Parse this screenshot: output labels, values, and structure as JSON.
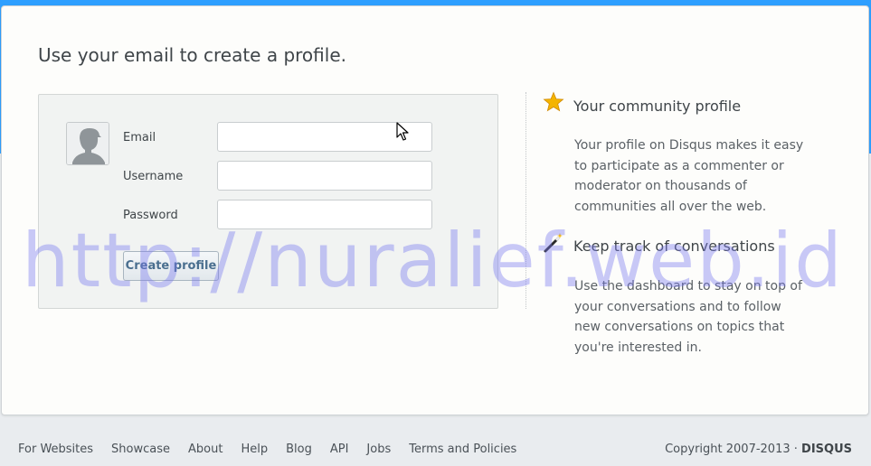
{
  "page": {
    "heading": "Use your email to create a profile."
  },
  "form": {
    "email_label": "Email",
    "email_value": "",
    "username_label": "Username",
    "username_value": "",
    "password_label": "Password",
    "password_value": "",
    "submit_label": "Create profile"
  },
  "features": [
    {
      "icon": "star-icon",
      "title": "Your community profile",
      "body": "Your profile on Disqus makes it easy to participate as a commenter or moderator on thousands of communities all over the web."
    },
    {
      "icon": "magic-wand-icon",
      "title": "Keep track of conversations",
      "body": "Use the dashboard to stay on top of your conversations and to follow new conversations on topics that you're interested in."
    }
  ],
  "watermark": "http://nuralief.web.id",
  "footer": {
    "links": [
      "For Websites",
      "Showcase",
      "About",
      "Help",
      "Blog",
      "API",
      "Jobs",
      "Terms and Policies"
    ],
    "copyright": "Copyright 2007-2013 · ",
    "brand": "DISQUS"
  },
  "colors": {
    "accent_blue": "#2e9fff",
    "button_text": "#4a6f8f",
    "star": "#f4b400"
  }
}
